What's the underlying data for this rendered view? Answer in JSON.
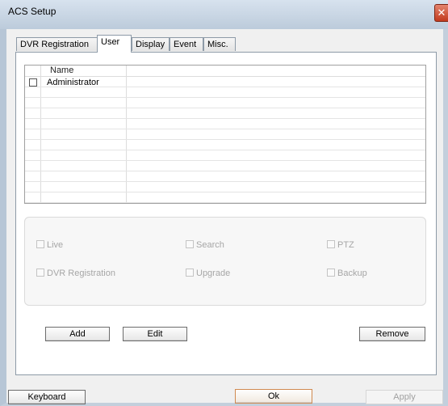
{
  "window": {
    "title": "ACS Setup",
    "close_glyph": "✕"
  },
  "tabs": [
    {
      "label": "DVR Registration"
    },
    {
      "label": "User"
    },
    {
      "label": "Display"
    },
    {
      "label": "Event"
    },
    {
      "label": "Misc."
    }
  ],
  "active_tab": "User",
  "user_table": {
    "columns": [
      "Name"
    ],
    "rows": [
      {
        "name": "Administrator",
        "checked": false
      }
    ]
  },
  "permissions": {
    "live": "Live",
    "search": "Search",
    "ptz": "PTZ",
    "dvr_registration": "DVR Registration",
    "upgrade": "Upgrade",
    "backup": "Backup"
  },
  "actions": {
    "add": "Add",
    "edit": "Edit",
    "remove": "Remove"
  },
  "footer": {
    "keyboard": "Keyboard",
    "ok": "Ok",
    "apply": "Apply"
  },
  "icons": {
    "close": "close-icon",
    "checkbox": "checkbox-icon"
  },
  "colors": {
    "close_button": "#c23a1e",
    "title_bar": "#bccbdb",
    "ok_border": "#d08a50"
  }
}
